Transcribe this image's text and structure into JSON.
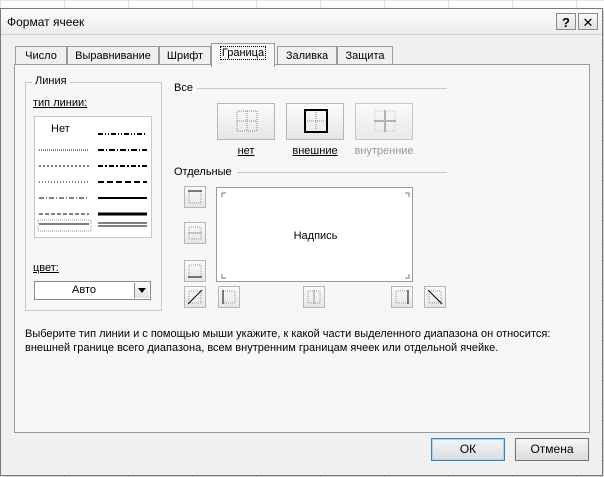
{
  "dialog": {
    "title": "Формат ячеек",
    "help_label": "?",
    "close_label": "✕"
  },
  "tabs": [
    {
      "label": "Число"
    },
    {
      "label": "Выравнивание"
    },
    {
      "label": "Шрифт"
    },
    {
      "label": "Граница",
      "active": true
    },
    {
      "label": "Заливка"
    },
    {
      "label": "Защита"
    }
  ],
  "line_group": {
    "legend": "Линия",
    "style_label": "тип линии:",
    "style_none": "Нет",
    "color_label": "цвет:",
    "color_value": "Авто"
  },
  "presets": {
    "heading": "Все",
    "none_label": "нет",
    "outline_label": "внешние",
    "inside_label": "внутренние"
  },
  "border": {
    "heading": "Отдельные",
    "preview_text": "Надпись"
  },
  "info": {
    "line1": "Выберите тип линии и с помощью мыши укажите, к какой части выделенного диапазона он относится:",
    "line2": "внешней границе всего диапазона, всем внутренним границам ячеек или отдельной ячейке."
  },
  "buttons": {
    "ok": "ОК",
    "cancel": "Отмена"
  }
}
